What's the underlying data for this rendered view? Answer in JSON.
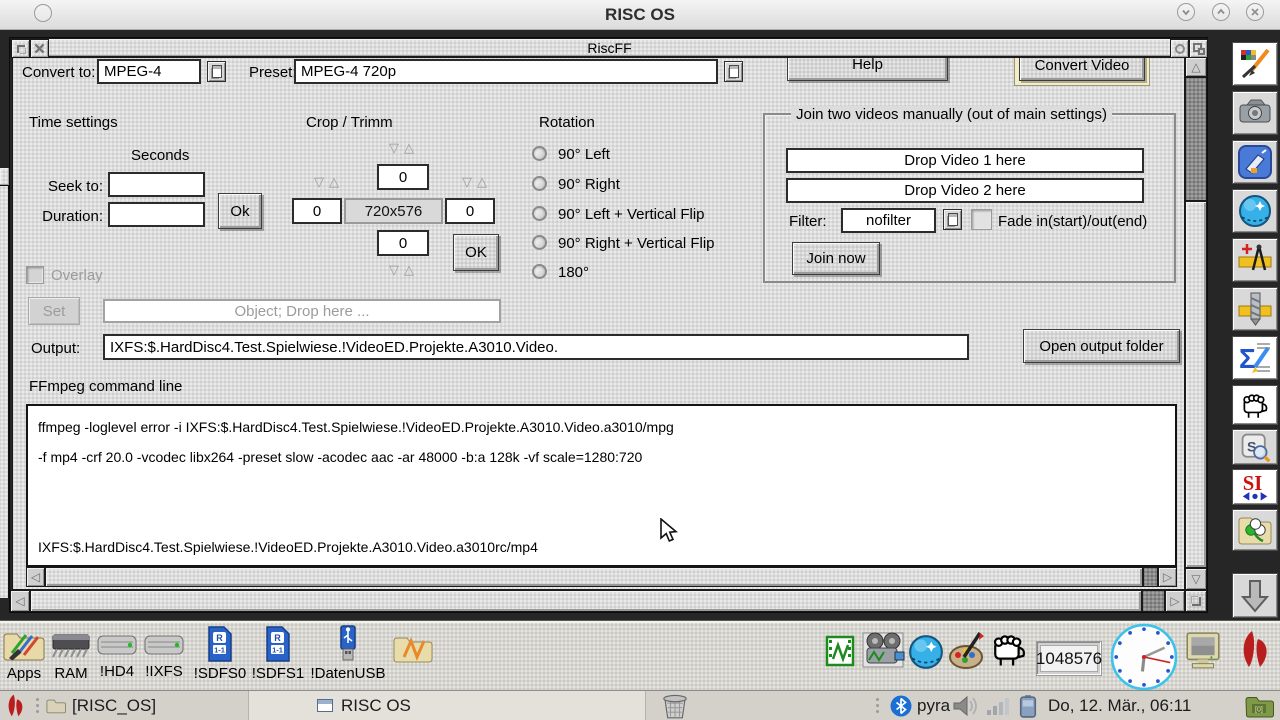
{
  "host": {
    "title": "RISC OS"
  },
  "glyphs": {
    "spinner": "▽△",
    "scroll_up": "△",
    "scroll_down": "▽",
    "scroll_left": "◁",
    "scroll_right": "▷"
  },
  "window": {
    "title": "RiscFF",
    "convert_to_label": "Convert to:",
    "convert_to_value": "MPEG-4",
    "preset_label": "Preset:",
    "preset_value": "MPEG-4 720p",
    "help_label": "Help",
    "convert_video_label": "Convert Video",
    "time": {
      "section_label": "Time settings",
      "seconds_label": "Seconds",
      "seek_label": "Seek to:",
      "seek_value": "",
      "duration_label": "Duration:",
      "duration_value": "",
      "ok_label": "Ok",
      "overlay_label": "Overlay"
    },
    "crop": {
      "section_label": "Crop / Trimm",
      "top_value": "0",
      "left_value": "0",
      "size_value": "720x576",
      "right_value": "0",
      "bottom_value": "0",
      "ok_label": "OK"
    },
    "rotation": {
      "section_label": "Rotation",
      "options": [
        {
          "label": "90° Left"
        },
        {
          "label": "90° Right"
        },
        {
          "label": "90° Left + Vertical Flip"
        },
        {
          "label": "90° Right + Vertical Flip"
        },
        {
          "label": "180°"
        }
      ]
    },
    "join": {
      "section_label": "Join two videos manually (out of main settings)",
      "drop1_label": "Drop Video 1 here",
      "drop2_label": "Drop Video 2 here",
      "filter_label": "Filter:",
      "filter_value": "nofilter",
      "fade_label": "Fade in(start)/out(end)",
      "join_now_label": "Join now"
    },
    "object_row": {
      "set_label": "Set",
      "object_placeholder": "Object; Drop here ..."
    },
    "output_row": {
      "label": "Output:",
      "value": "IXFS:$.HardDisc4.Test.Spielwiese.!VideoED.Projekte.A3010.Video.",
      "open_folder_label": "Open output folder"
    },
    "command": {
      "label": "FFmpeg command line",
      "line1": "ffmpeg -loglevel error -i IXFS:$.HardDisc4.Test.Spielwiese.!VideoED.Projekte.A3010.Video.a3010/mpg",
      "line2": "-f mp4 -crf 20.0 -vcodec libx264 -preset slow -acodec aac -ar 48000 -b:a 128k -vf scale=1280:720",
      "line3": "IXFS:$.HardDisc4.Test.Spielwiese.!VideoED.Projekte.A3010.Video.a3010rc/mp4"
    }
  },
  "iconbar": {
    "left": [
      {
        "label": "Apps"
      },
      {
        "label": "RAM"
      },
      {
        "label": "!HD4"
      },
      {
        "label": "!IXFS"
      },
      {
        "label": "!SDFS0"
      },
      {
        "label": "!SDFS1"
      },
      {
        "label": "!DatenUSB"
      }
    ],
    "sd_badge_top": "R",
    "sd_badge_bottom": "1-1",
    "memory_value": "1048576"
  },
  "statusbar": {
    "workspace_label": "[RISC_OS]",
    "active_task_label": "RISC OS",
    "bt_device_label": "pyra",
    "datetime_label": "Do, 12. Mär., 06:11"
  },
  "colors": {
    "desktop": "#262626",
    "window_grey": "#dcdcdc",
    "default_ring_cream": "#f1edc6",
    "sd_blue": "#2a63c8",
    "led_green": "#22bb22",
    "logo_red": "#b91d1d",
    "clock_ring": "#3cc3ea"
  }
}
